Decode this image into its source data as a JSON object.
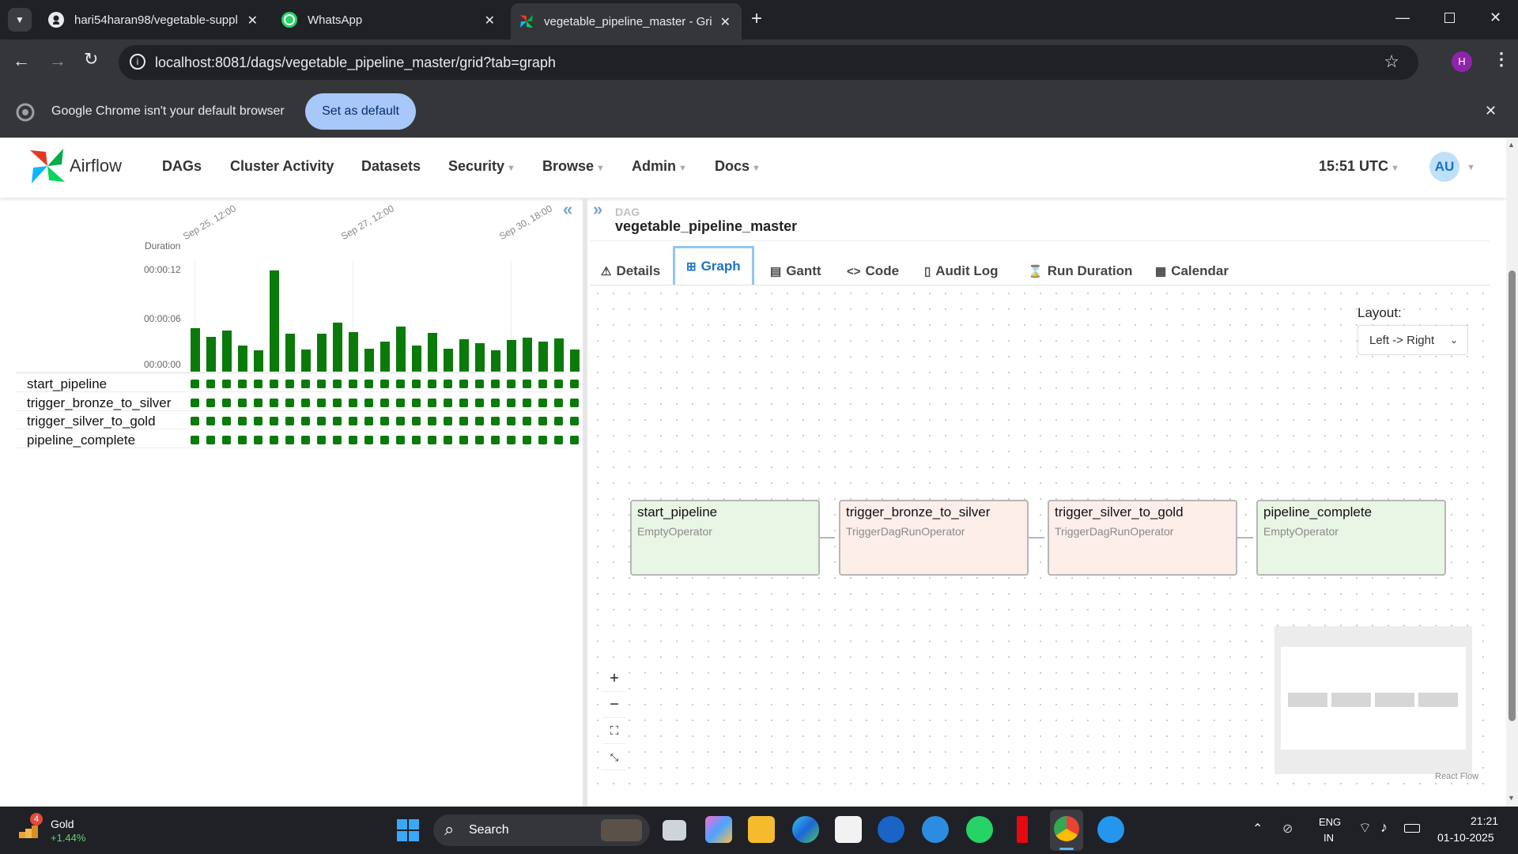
{
  "browser": {
    "tabs": [
      {
        "title": "hari54haran98/vegetable-suppl",
        "icon": "github-icon"
      },
      {
        "title": "WhatsApp",
        "icon": "whatsapp-icon"
      },
      {
        "title": "vegetable_pipeline_master - Gri",
        "icon": "airflow-icon"
      }
    ],
    "url": "localhost:8081/dags/vegetable_pipeline_master/grid?tab=graph",
    "profile_initial": "H",
    "infobar": {
      "message": "Google Chrome isn't your default browser",
      "button": "Set as default"
    }
  },
  "airflow": {
    "logo_text": "Airflow",
    "nav": [
      "DAGs",
      "Cluster Activity",
      "Datasets",
      "Security",
      "Browse",
      "Admin",
      "Docs"
    ],
    "time": "15:51 UTC",
    "user_initials": "AU"
  },
  "grid": {
    "duration_label": "Duration",
    "y_ticks": [
      "00:00:12",
      "00:00:06",
      "00:00:00"
    ],
    "x_labels": [
      "Sep 25, 12:00",
      "Sep 27, 12:00",
      "Sep 30, 18:00"
    ],
    "tasks": [
      "start_pipeline",
      "trigger_bronze_to_silver",
      "trigger_silver_to_gold",
      "pipeline_complete"
    ],
    "status_color": "#0a7a0a"
  },
  "chart_data": {
    "type": "bar",
    "title": "",
    "ylabel": "Duration",
    "y_unit": "seconds",
    "ylim": [
      0,
      12
    ],
    "values": [
      5.2,
      4.2,
      5.0,
      3.1,
      2.6,
      12.2,
      4.6,
      2.7,
      4.6,
      5.9,
      4.8,
      2.8,
      3.6,
      5.4,
      3.1,
      4.7,
      2.8,
      3.9,
      3.4,
      2.6,
      3.8,
      4.1,
      3.6,
      4.0,
      2.7
    ]
  },
  "dag": {
    "label": "DAG",
    "name": "vegetable_pipeline_master",
    "tabs": [
      "Details",
      "Graph",
      "Gantt",
      "Code",
      "Audit Log",
      "Run Duration",
      "Calendar"
    ],
    "active_tab": "Graph",
    "layout_label": "Layout:",
    "layout_value": "Left -> Right",
    "nodes": [
      {
        "name": "start_pipeline",
        "operator": "EmptyOperator",
        "color": "#e9f5e5"
      },
      {
        "name": "trigger_bronze_to_silver",
        "operator": "TriggerDagRunOperator",
        "color": "#fdeeea"
      },
      {
        "name": "trigger_silver_to_gold",
        "operator": "TriggerDagRunOperator",
        "color": "#fdeeea"
      },
      {
        "name": "pipeline_complete",
        "operator": "EmptyOperator",
        "color": "#e9f5e5"
      }
    ],
    "attribution": "React Flow"
  },
  "taskbar": {
    "weather_badge": "4",
    "stock_name": "Gold",
    "stock_change": "+1.44%",
    "search_placeholder": "Search",
    "lang": "ENG",
    "region": "IN",
    "time": "21:21",
    "date": "01-10-2025"
  }
}
